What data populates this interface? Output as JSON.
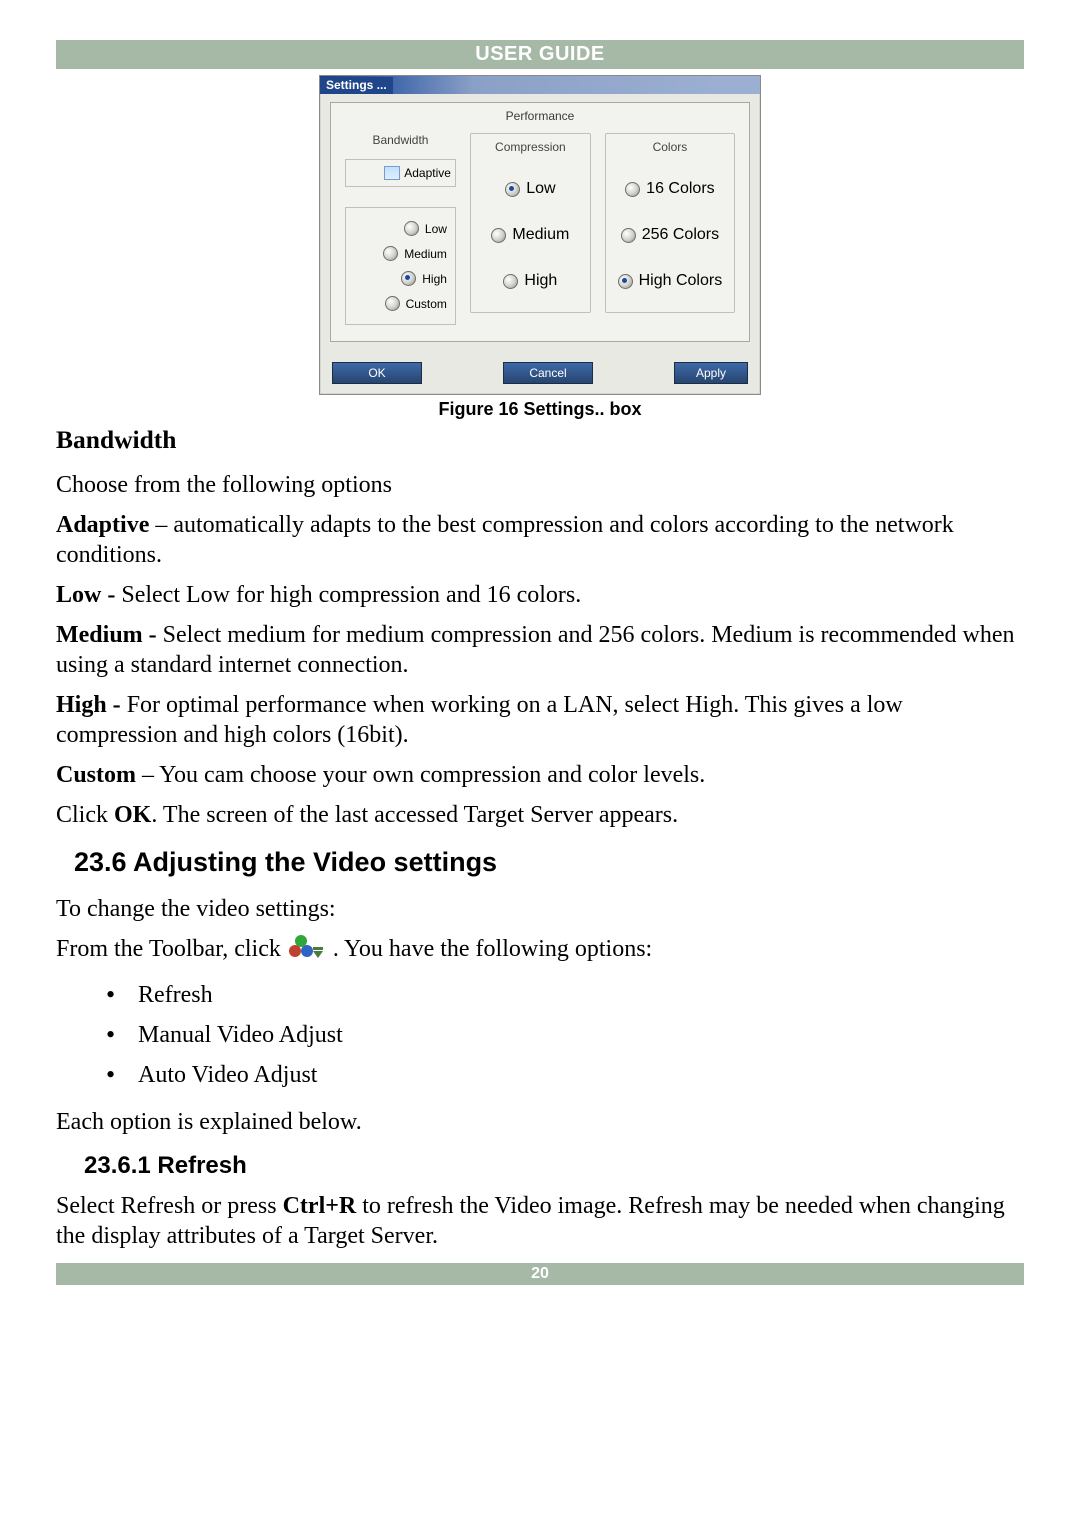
{
  "header": "USER GUIDE",
  "dialog": {
    "title": "Settings ...",
    "panel_label": "Performance",
    "columns": {
      "bandwidth": {
        "label": "Bandwidth",
        "adaptive": "Adaptive",
        "opts": [
          "Low",
          "Medium",
          "High",
          "Custom"
        ],
        "selected": "High"
      },
      "compression": {
        "label": "Compression",
        "opts": [
          "Low",
          "Medium",
          "High"
        ],
        "selected": "Low"
      },
      "colors": {
        "label": "Colors",
        "opts": [
          "16 Colors",
          "256 Colors",
          "High Colors"
        ],
        "selected": "High Colors"
      }
    },
    "buttons": {
      "ok": "OK",
      "cancel": "Cancel",
      "apply": "Apply"
    }
  },
  "caption": "Figure 16 Settings.. box",
  "sections": {
    "bandwidth_heading": "Bandwidth",
    "intro": "Choose from the following options",
    "adaptive_b": "Adaptive",
    "adaptive_t": " – automatically adapts to the best compression and colors according to the network conditions.",
    "low_b": "Low - ",
    "low_t": "Select Low for high compression and 16 colors.",
    "medium_b": "Medium - ",
    "medium_t": "Select medium for medium compression and 256 colors. Medium is recommended when using a standard internet connection.",
    "high_b": "High - ",
    "high_t": "For optimal performance when working on a LAN, select High. This gives a low compression and high colors (16bit).",
    "custom_b": "Custom",
    "custom_t": " – You cam choose your own compression and color levels.",
    "click_pre": "Click ",
    "click_b": "OK",
    "click_post": ". The screen of the last accessed Target Server appears.",
    "video_heading": "23.6 Adjusting the Video settings",
    "video_intro": "To change the video settings:",
    "toolbar_pre": "From the Toolbar, click ",
    "toolbar_post": ". You have the following options:",
    "opts": [
      "Refresh",
      "Manual Video Adjust",
      "Auto Video Adjust"
    ],
    "explain": "Each option is explained below.",
    "refresh_heading": "23.6.1 Refresh",
    "refresh_pre": "Select Refresh or press ",
    "refresh_b": "Ctrl+R",
    "refresh_post": " to refresh the Video image. Refresh may be needed when changing the display attributes of a Target Server."
  },
  "page_number": "20"
}
